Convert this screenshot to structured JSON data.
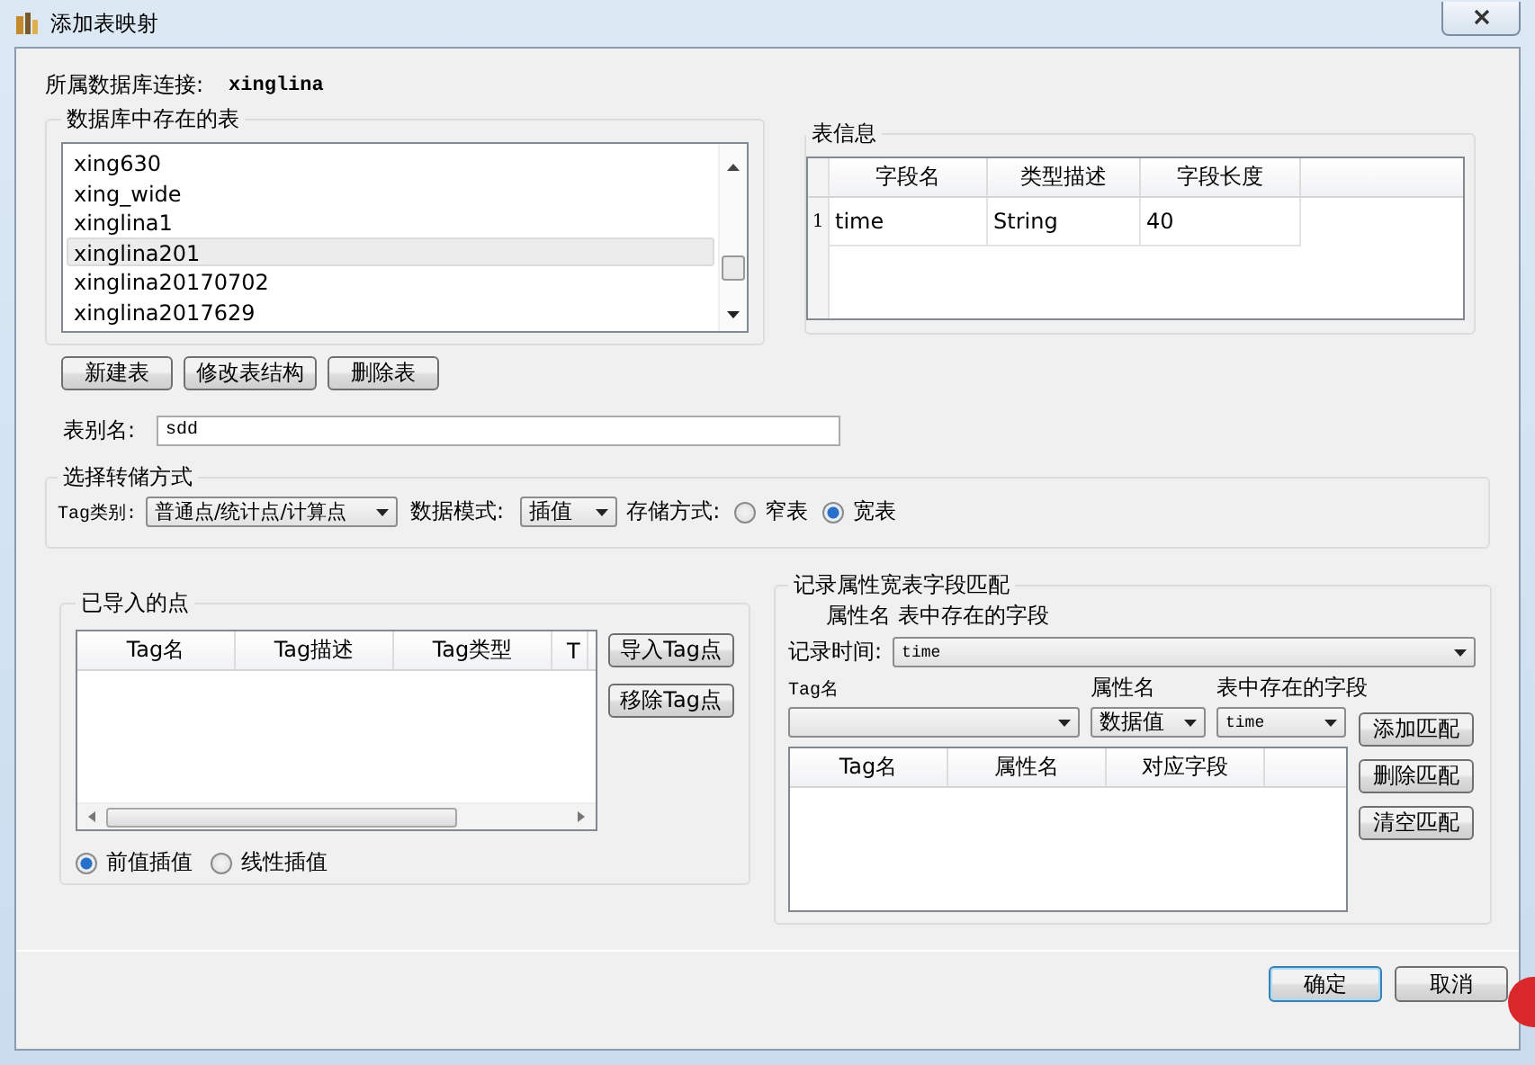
{
  "window": {
    "title": "添加表映射"
  },
  "connection": {
    "label": "所属数据库连接:",
    "value": "xinglina"
  },
  "tables_group": {
    "title": "数据库中存在的表",
    "items": [
      {
        "label": "xing630",
        "selected": false
      },
      {
        "label": "xing_wide",
        "selected": false
      },
      {
        "label": "xinglina1",
        "selected": false
      },
      {
        "label": "xinglina201",
        "selected": true
      },
      {
        "label": "xinglina20170702",
        "selected": false
      },
      {
        "label": "xinglina2017629",
        "selected": false
      }
    ]
  },
  "table_info": {
    "title": "表信息",
    "columns": [
      "字段名",
      "类型描述",
      "字段长度"
    ],
    "rows": [
      {
        "index": "1",
        "cells": [
          "time",
          "String",
          "40"
        ]
      }
    ]
  },
  "table_buttons": [
    "新建表",
    "修改表结构",
    "删除表"
  ],
  "alias": {
    "label": "表别名:",
    "value": "sdd"
  },
  "storage": {
    "title": "选择转储方式",
    "tag_type": {
      "label": "Tag类别:",
      "value": "普通点/统计点/计算点"
    },
    "data_mode": {
      "label": "数据模式:",
      "value": "插值"
    },
    "storage_mode": {
      "label": "存储方式:",
      "options": [
        {
          "label": "窄表",
          "selected": false
        },
        {
          "label": "宽表",
          "selected": true
        }
      ]
    }
  },
  "imported": {
    "title": "已导入的点",
    "columns": [
      "Tag名",
      "Tag描述",
      "Tag类型",
      "T"
    ],
    "buttons": [
      "导入Tag点",
      "移除Tag点"
    ],
    "interpolation": [
      {
        "label": "前值插值",
        "selected": true
      },
      {
        "label": "线性插值",
        "selected": false
      }
    ]
  },
  "matching": {
    "title": "记录属性宽表字段匹配",
    "header": "属性名 表中存在的字段",
    "record_time": {
      "label": "记录时间:",
      "value": "time"
    },
    "labels": [
      "Tag名",
      "属性名",
      "表中存在的字段"
    ],
    "attr_value": "数据值",
    "field_value": "time",
    "columns": [
      "Tag名",
      "属性名",
      "对应字段"
    ],
    "buttons": [
      "添加匹配",
      "删除匹配",
      "清空匹配"
    ]
  },
  "footer": {
    "buttons": [
      {
        "label": "确定",
        "default": true
      },
      {
        "label": "取消",
        "default": false
      }
    ]
  }
}
